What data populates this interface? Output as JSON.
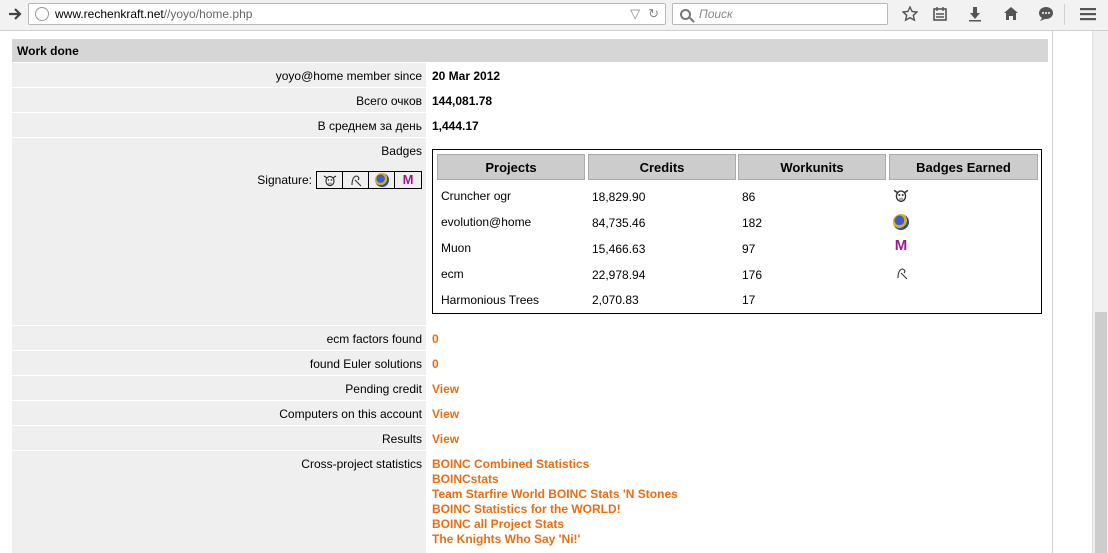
{
  "browser": {
    "url_domain": "www.rechenkraft.net",
    "url_path": "//yoyo/home.php",
    "search_placeholder": "Поиск"
  },
  "section": {
    "title": "Work done"
  },
  "rows": {
    "member_since": {
      "label": "yoyo@home member since",
      "value": "20 Mar 2012"
    },
    "total_credit": {
      "label": "Всего очков",
      "value": "144,081.78"
    },
    "avg_credit": {
      "label": "В среднем за день",
      "value": "1,444.17"
    },
    "badges": {
      "label": "Badges",
      "signature_label": "Signature:"
    },
    "ecm_factors": {
      "label": "ecm factors found",
      "value": "0"
    },
    "euler": {
      "label": "found Euler solutions",
      "value": "0"
    },
    "pending": {
      "label": "Pending credit",
      "value": "View"
    },
    "computers": {
      "label": "Computers on this account",
      "value": "View"
    },
    "results": {
      "label": "Results",
      "value": "View"
    },
    "cross": {
      "label": "Cross-project statistics"
    }
  },
  "badge_table": {
    "headers": [
      "Projects",
      "Credits",
      "Workunits",
      "Badges Earned"
    ],
    "rows": [
      {
        "project": "Cruncher ogr",
        "credits": "18,829.90",
        "workunits": "86",
        "badge": "cow-badge-icon"
      },
      {
        "project": "evolution@home",
        "credits": "84,735.46",
        "workunits": "182",
        "badge": "globe-badge-icon"
      },
      {
        "project": "Muon",
        "credits": "15,466.63",
        "workunits": "97",
        "badge": "muon-badge-icon"
      },
      {
        "project": "ecm",
        "credits": "22,978.94",
        "workunits": "176",
        "badge": "ecm-badge-icon"
      },
      {
        "project": "Harmonious Trees",
        "credits": "2,070.83",
        "workunits": "17",
        "badge": ""
      }
    ]
  },
  "cross_links": [
    "BOINC Combined Statistics",
    "BOINCstats",
    "Team Starfire World BOINC Stats 'N Stones",
    "BOINC Statistics for the WORLD!",
    "BOINC all Project Stats",
    "The Knights Who Say 'Ni!'"
  ],
  "colors": {
    "link": "#e86e14",
    "label_bg": "#efefef",
    "header_bg": "#d6d6d6"
  }
}
